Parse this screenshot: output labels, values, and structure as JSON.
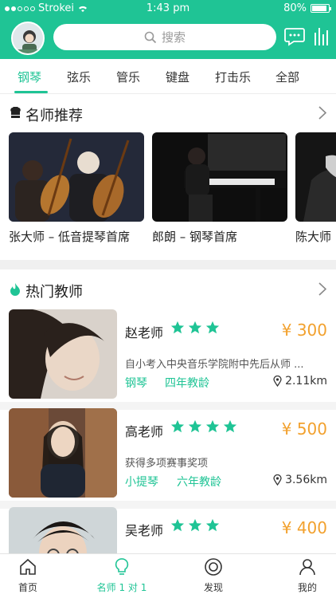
{
  "status_bar": {
    "carrier": "Strokei",
    "time": "1:43 pm",
    "battery": "80%"
  },
  "header": {
    "search_placeholder": "搜索",
    "avatar_icon": "avatar-icon",
    "message_icon": "message-icon",
    "bars_icon": "bars-icon"
  },
  "tabs": [
    "钢琴",
    "弦乐",
    "管乐",
    "键盘",
    "打击乐",
    "全部"
  ],
  "featured": {
    "title": "名师推荐",
    "items": [
      {
        "caption": "张大师 – 低音提琴首席"
      },
      {
        "caption": "郎朗 – 钢琴首席"
      },
      {
        "caption": "陈大师"
      }
    ]
  },
  "popular": {
    "title": "热门教师",
    "teachers": [
      {
        "name": "赵老师",
        "rating": 3,
        "price": "¥ 300",
        "desc": "自小考入中央音乐学院附中先后从师 ...",
        "instrument": "钢琴",
        "years": "四年教龄",
        "distance": "2.11km"
      },
      {
        "name": "高老师",
        "rating": 4,
        "price": "¥ 500",
        "desc": "获得多项赛事奖项",
        "instrument": "小提琴",
        "years": "六年教龄",
        "distance": "3.56km"
      },
      {
        "name": "吴老师",
        "rating": 3,
        "price": "¥ 400"
      }
    ]
  },
  "bottom_nav": [
    {
      "label": "首页",
      "icon": "home-icon"
    },
    {
      "label": "名师 1 对 1",
      "icon": "bulb-icon"
    },
    {
      "label": "发现",
      "icon": "discover-icon"
    },
    {
      "label": "我的",
      "icon": "user-icon"
    }
  ],
  "colors": {
    "accent": "#1fc495",
    "price": "#f2a12e"
  }
}
